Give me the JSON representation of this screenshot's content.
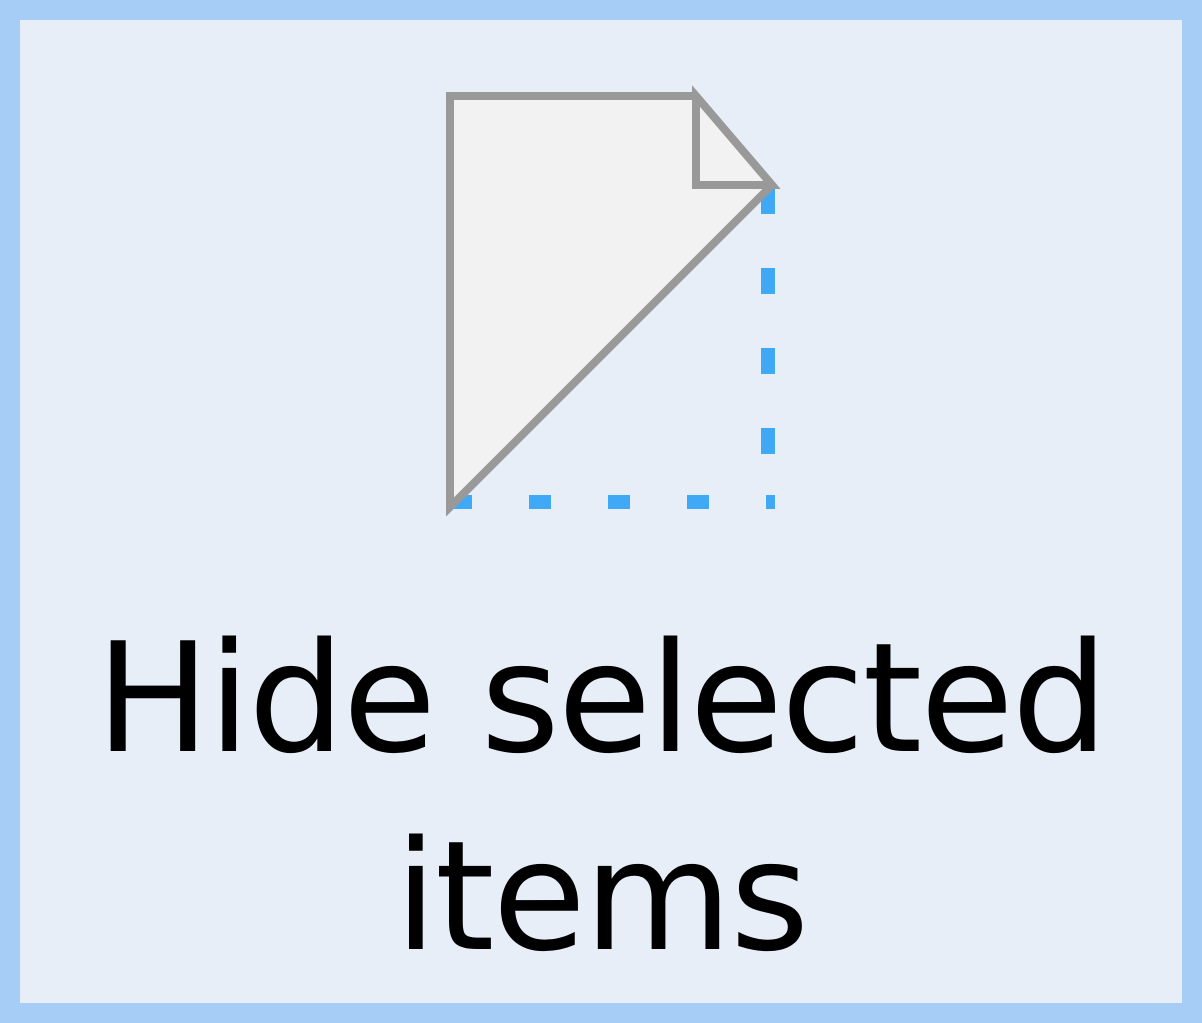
{
  "button": {
    "label_line1": "Hide selected",
    "label_line2": "items",
    "icon": "hide-selected-items-icon"
  },
  "colors": {
    "border": "#a6cdf6",
    "background": "#e7eef7",
    "icon_outline": "#999999",
    "icon_fill": "#f2f2f2",
    "dashed_accent": "#3fa9f5",
    "text": "#000000"
  }
}
